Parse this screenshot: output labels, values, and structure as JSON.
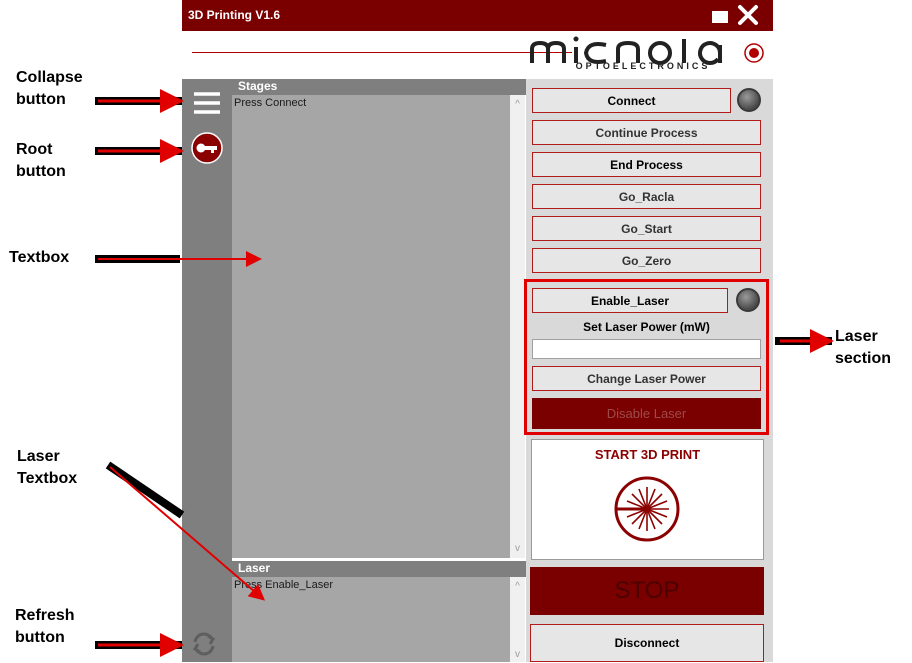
{
  "window": {
    "title": "3D Printing V1.6"
  },
  "logo": {
    "name": "micnola",
    "sub": "OPTOELECTRONICS"
  },
  "stages": {
    "header": "Stages",
    "text": "Press Connect"
  },
  "laser_box": {
    "header": "Laser",
    "text": "Press Enable_Laser"
  },
  "buttons": {
    "connect": "Connect",
    "continue_process": "Continue Process",
    "end_process": "End Process",
    "go_racla": "Go_Racla",
    "go_start": "Go_Start",
    "go_zero": "Go_Zero",
    "enable_laser": "Enable_Laser",
    "set_laser_power_label": "Set Laser Power (mW)",
    "change_laser_power": "Change Laser Power",
    "disable_laser": "Disable Laser",
    "start_3d_print": "START 3D PRINT",
    "stop": "STOP",
    "disconnect": "Disconnect"
  },
  "annotations": {
    "collapse_line1": "Collapse",
    "collapse_line2": "button",
    "root_line1": "Root",
    "root_line2": "button",
    "textbox": "Textbox",
    "laser_textbox_line1": "Laser",
    "laser_textbox_line2": "Textbox",
    "refresh_line1": "Refresh",
    "refresh_line2": "button",
    "laser_section_line1": "Laser",
    "laser_section_line2": "section"
  },
  "colors": {
    "brand_dark_red": "#7a0000",
    "accent_red": "#e00000",
    "sidebar_gray": "#7f7f7f",
    "textbox_gray": "#a6a6a6"
  },
  "icons": [
    "menu-icon",
    "key-icon",
    "refresh-icon",
    "minimize-icon",
    "close-icon",
    "laser-burst-icon",
    "led-indicator"
  ]
}
